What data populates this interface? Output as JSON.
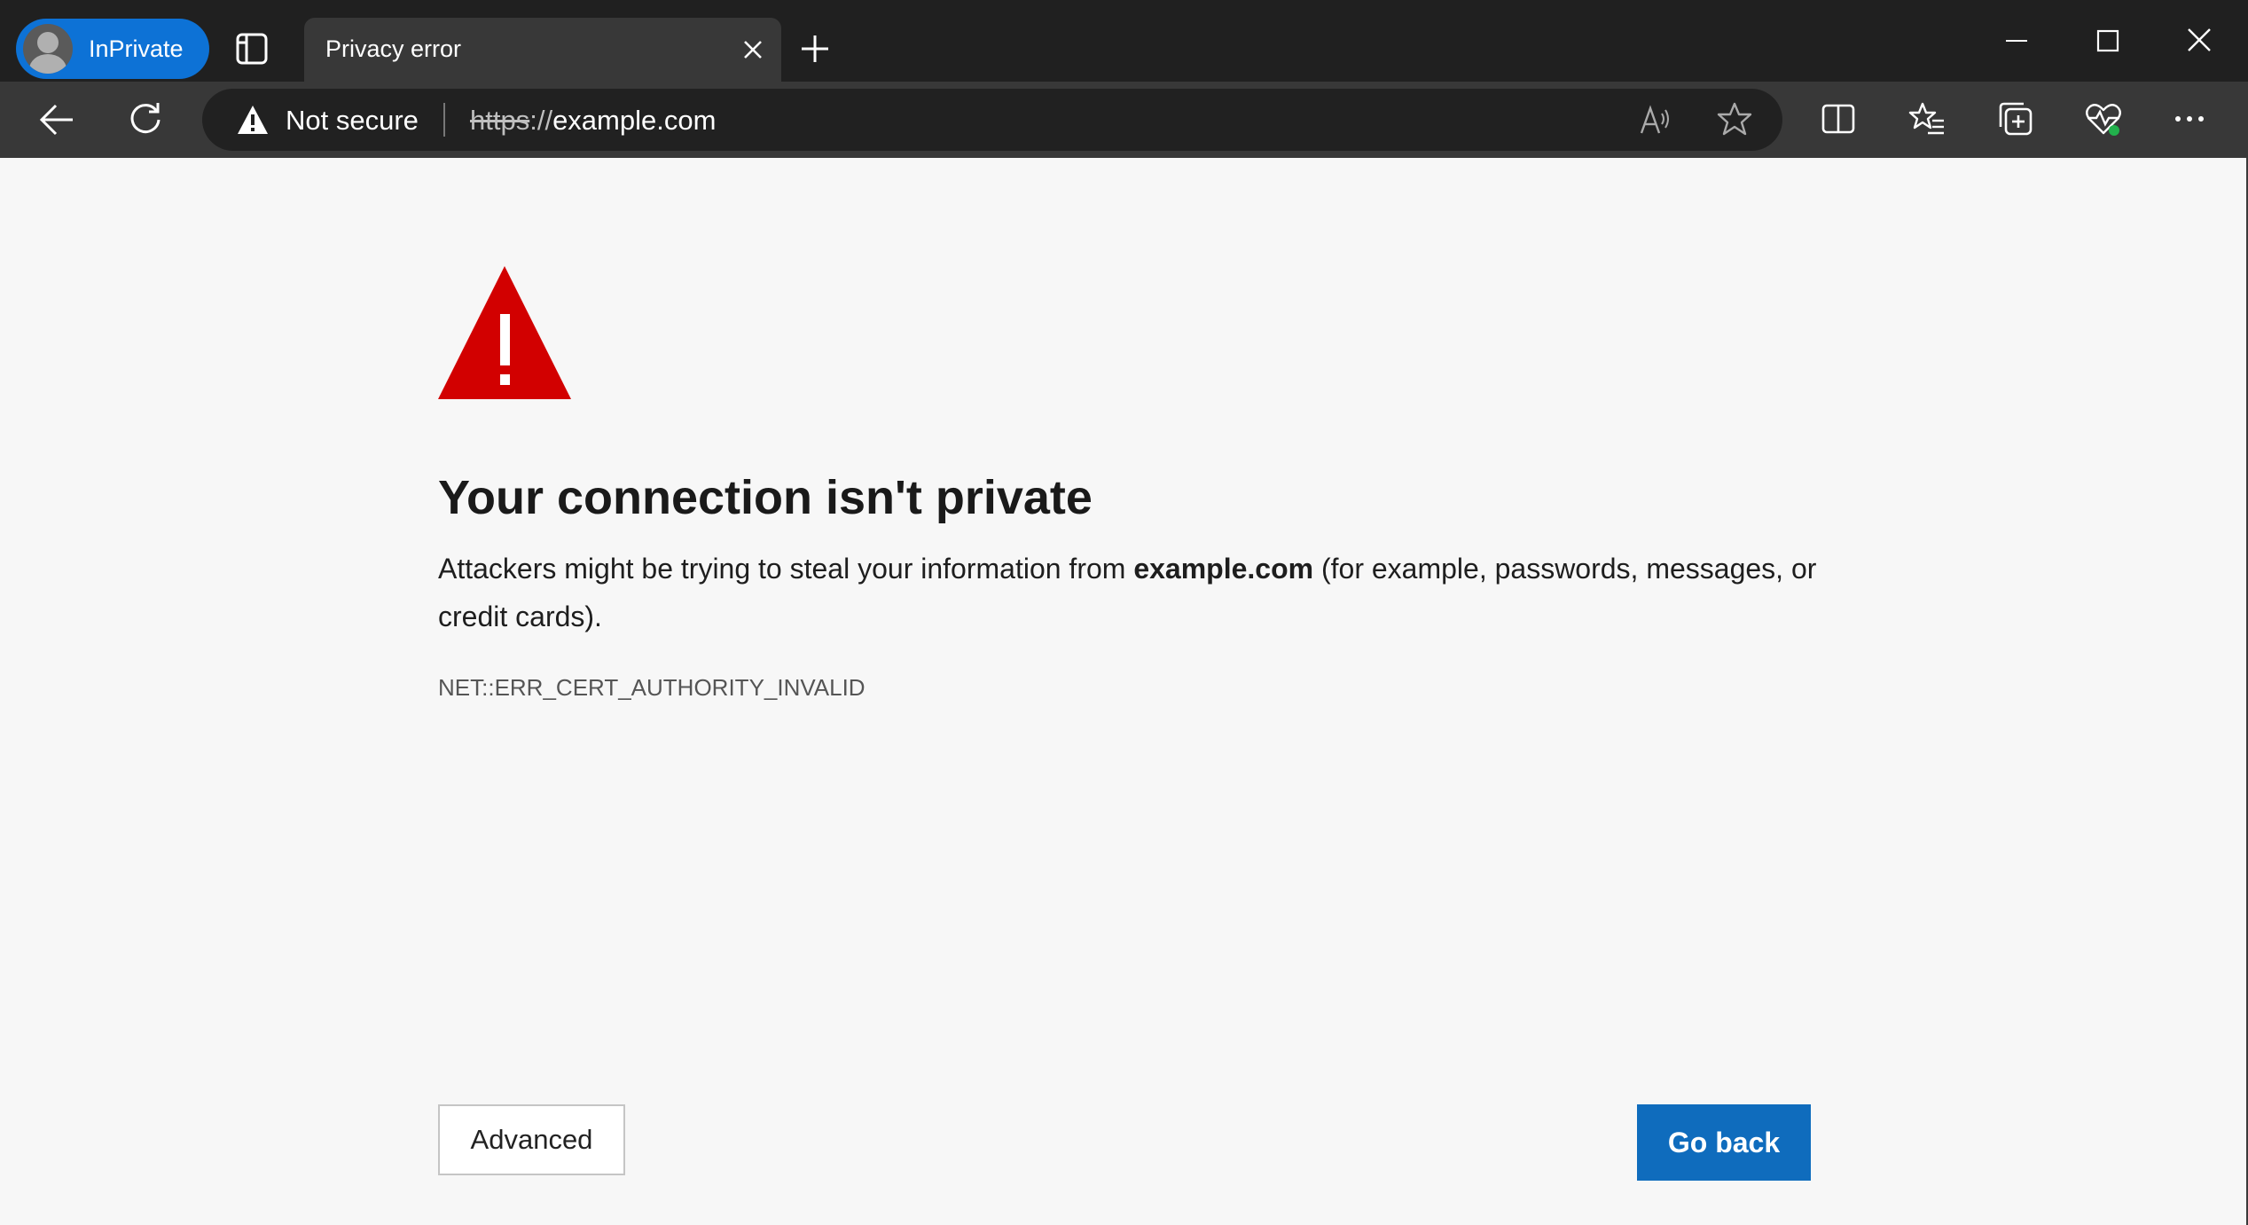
{
  "browser": {
    "profile_label": "InPrivate",
    "tab_title": "Privacy error",
    "security_label": "Not secure",
    "url": {
      "scheme": "https",
      "separator": "://",
      "host": "example.com"
    }
  },
  "icons": {
    "back": "back-arrow-icon",
    "refresh": "refresh-icon",
    "read_aloud": "read-aloud-icon",
    "favorite": "star-icon",
    "split_screen": "split-screen-icon",
    "favorites": "favorites-icon",
    "collections": "collections-icon",
    "browser_essentials": "heartbeat-icon",
    "more": "more-icon"
  },
  "page": {
    "title": "Your connection isn't private",
    "desc_before": "Attackers might be trying to steal your information from ",
    "desc_host": "example.com",
    "desc_after": " (for example, passwords, messages, or credit cards).",
    "error_code": "NET::ERR_CERT_AUTHORITY_INVALID",
    "advanced_label": "Advanced",
    "go_back_label": "Go back"
  },
  "colors": {
    "accent": "#0f6cbd",
    "warning_red": "#d20000",
    "titlebar": "#202020",
    "toolbar": "#383838"
  }
}
